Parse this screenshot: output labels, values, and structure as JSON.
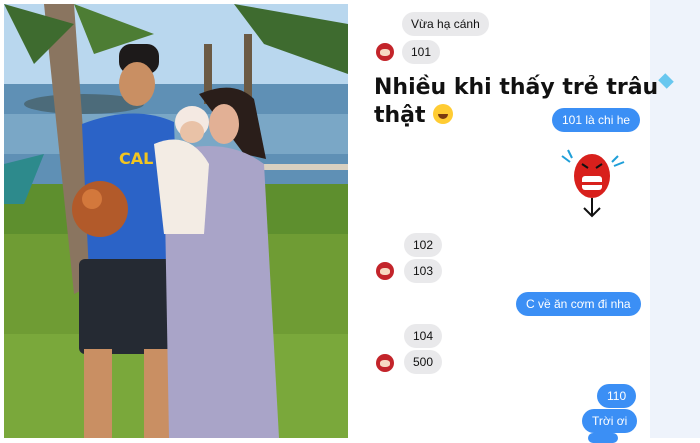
{
  "messages": {
    "m1": "Vừa hạ cánh",
    "m2": "101",
    "big_line1": "Nhiều khi thấy trẻ trâu",
    "big_line2": "thật",
    "m3": "101 là chi he",
    "m4": "102",
    "m5": "103",
    "m6": "C về ăn cơm đi nha",
    "m7": "104",
    "m8": "500",
    "m9": "110",
    "m10": "Trời ơi"
  },
  "photo": {
    "shirt_text": "CAL"
  },
  "colors": {
    "outgoing_bubble": "#3b8ff5",
    "incoming_bubble": "#e9e9eb",
    "avatar": "#c3242a"
  }
}
